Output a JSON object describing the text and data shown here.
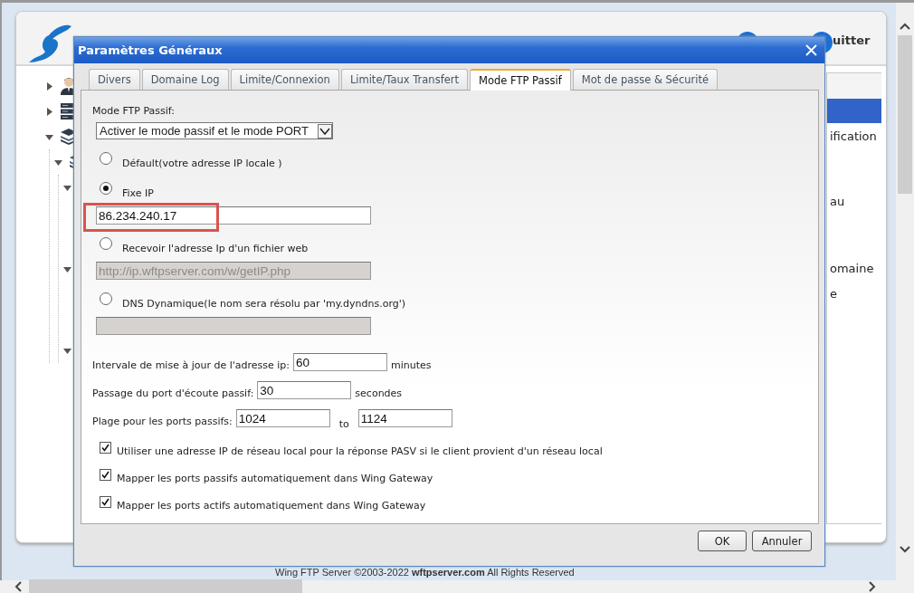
{
  "app": {
    "header_text": "uitter",
    "tree": [
      {
        "kind": "user",
        "expanded": false
      },
      {
        "kind": "server",
        "expanded": false
      },
      {
        "kind": "stack",
        "expanded": true,
        "children": [
          {
            "kind": "stack",
            "expanded": true,
            "children": [
              {
                "expanded": true
              },
              {
                "expanded": true
              },
              {
                "expanded": true
              }
            ]
          }
        ]
      }
    ],
    "right_panel": [
      {
        "selected": true
      },
      {
        "text": "ification",
        "selected": false
      },
      {
        "text": "au",
        "selected": false
      },
      {
        "text": "omaine",
        "selected": false
      },
      {
        "text": "e",
        "selected": false
      }
    ],
    "footer": "Wing FTP Server ©2003-2022 **wftpserver.com** All Rights Reserved"
  },
  "dialog": {
    "title": "Paramètres Généraux",
    "tabs": [
      {
        "label": "Divers",
        "selected": false
      },
      {
        "label": "Domaine Log",
        "selected": false
      },
      {
        "label": "Limite/Connexion",
        "selected": false
      },
      {
        "label": "Limite/Taux Transfert",
        "selected": false
      },
      {
        "label": "Mode FTP Passif",
        "selected": true
      },
      {
        "label": "Mot de passe & Sécurité",
        "selected": false
      }
    ],
    "mode_label": "Mode FTP Passif:",
    "mode_select": "Activer le mode passif et le mode PORT",
    "ip_options": [
      {
        "label": "Défault(votre adresse IP locale )",
        "selected": false
      },
      {
        "label": "Fixe IP",
        "selected": true,
        "field": {
          "value": "86.234.240.17",
          "disabled": false,
          "highlighted": true
        }
      },
      {
        "label": "Recevoir l'adresse Ip d'un fichier web",
        "selected": false,
        "field": {
          "value": "http://ip.wftpserver.com/w/getIP.php",
          "disabled": true
        }
      },
      {
        "label": "DNS Dynamique(le nom sera résolu par 'my.dyndns.org')",
        "selected": false,
        "field": {
          "disabled": true
        }
      }
    ],
    "interval": {
      "label": "Intervale de mise à jour de l'adresse ip:",
      "value": "60",
      "unit": "minutes"
    },
    "listen": {
      "label": "Passage du port d'écoute passif:",
      "value": "30",
      "unit": "secondes"
    },
    "range": {
      "label": "Plage pour les ports passifs:",
      "from": "1024",
      "to_label": "to",
      "to": "1124"
    },
    "checks": [
      {
        "label": "Utiliser une adresse IP de réseau local pour la réponse PASV si le client provient d'un réseau local",
        "checked": true
      },
      {
        "label": "Mapper les ports passifs automatiquement dans Wing Gateway",
        "checked": true
      },
      {
        "label": "Mapper les ports actifs automatiquement dans Wing Gateway",
        "checked": true
      }
    ],
    "buttons": [
      "OK",
      "Annuler"
    ]
  }
}
